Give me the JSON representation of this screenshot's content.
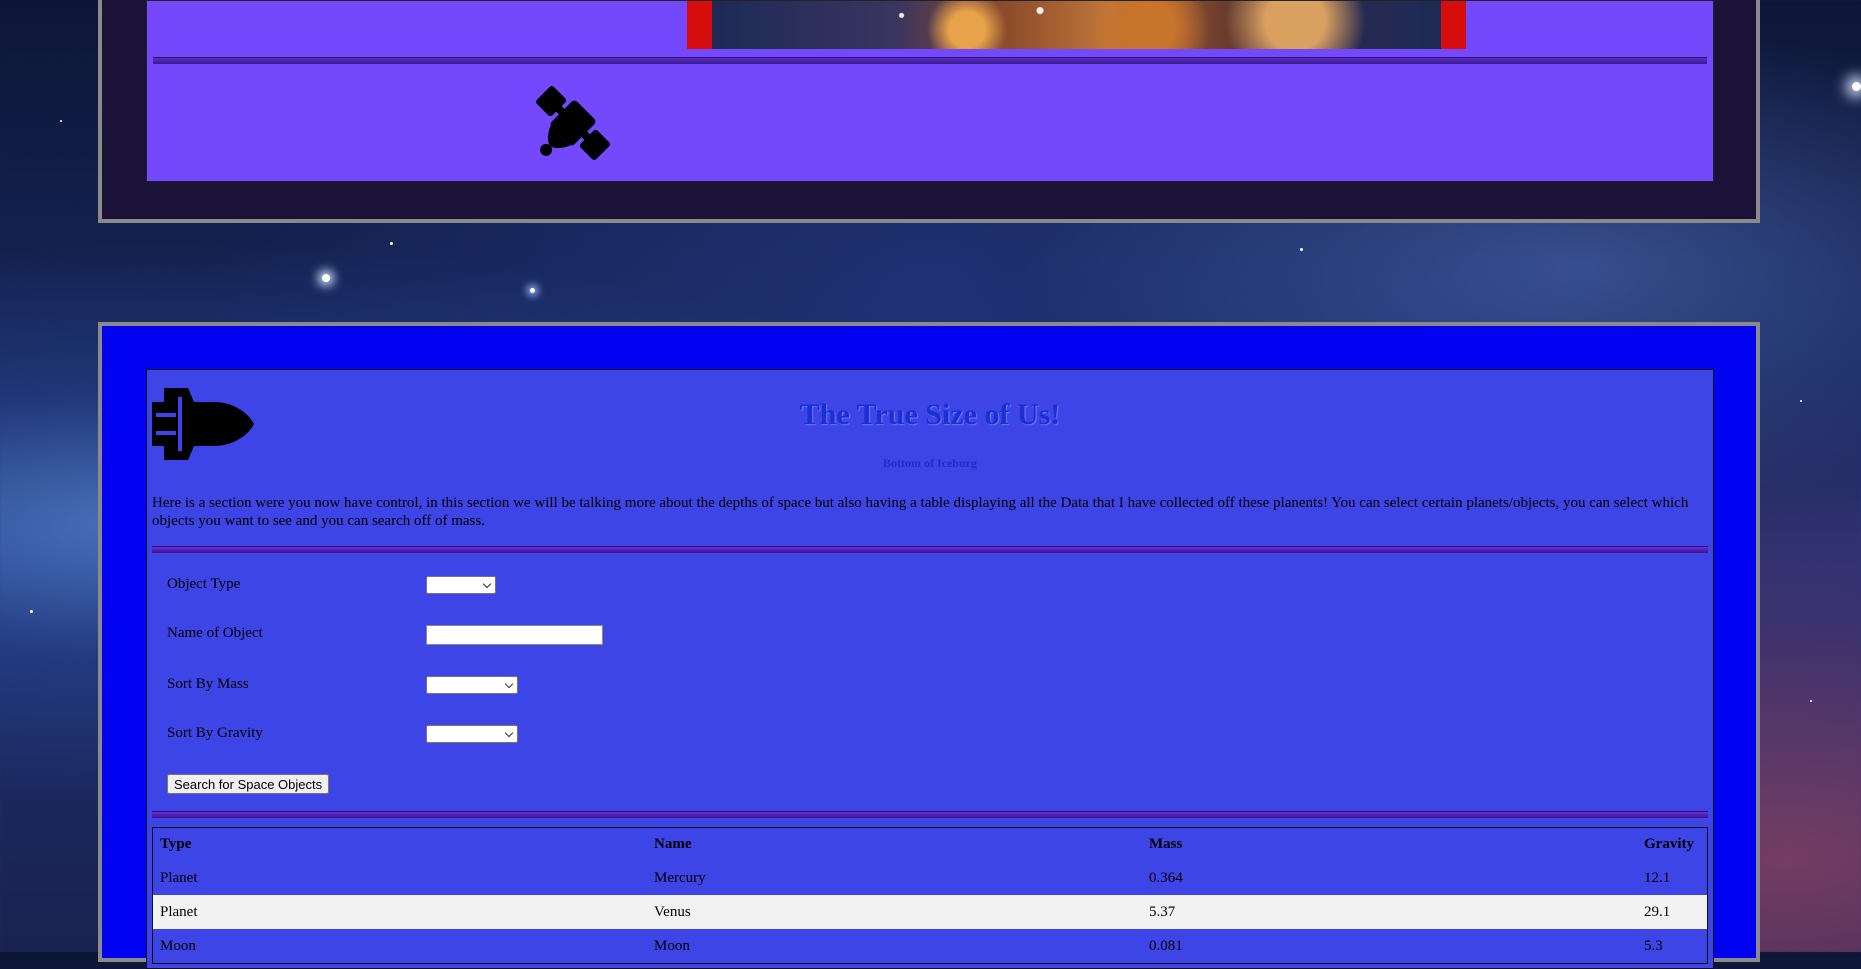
{
  "colors": {
    "top_panel": "#7449fe",
    "bottom_card": "#0202f2",
    "bottom_panel": "#3d45e6",
    "title": "#1c2fd1",
    "frame_border": "#8a8a8a"
  },
  "top_section": {
    "image_icon": "nebula-photo",
    "decor_icon": "satellite-icon"
  },
  "section": {
    "header_icon": "space-shuttle-icon",
    "title": "The True Size of Us!",
    "subtitle": "Bottom of Iceburg",
    "intro": "Here is a section were you now have control, in this section we will be talking more about the depths of space but also having a table displaying all the Data that I have collected off these planents! You can select certain planets/objects, you can select which objects you want to see and you can search off of mass."
  },
  "form": {
    "object_type_label": "Object Type",
    "object_type_value": "",
    "name_label": "Name of Object",
    "name_value": "",
    "mass_label": "Sort By Mass",
    "mass_value": "",
    "gravity_label": "Sort By Gravity",
    "gravity_value": "",
    "search_button": "Search for Space Objects"
  },
  "table": {
    "headers": [
      "Type",
      "Name",
      "Mass",
      "Gravity"
    ],
    "rows": [
      [
        "Planet",
        "Mercury",
        "0.364",
        "12.1"
      ],
      [
        "Planet",
        "Venus",
        "5.37",
        "29.1"
      ],
      [
        "Moon",
        "Moon",
        "0.081",
        "5.3"
      ]
    ]
  }
}
